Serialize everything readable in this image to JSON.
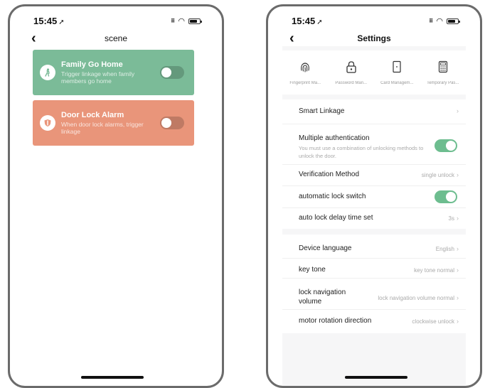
{
  "scene_screen": {
    "status": {
      "time": "15:45"
    },
    "title": "scene",
    "cards": [
      {
        "title": "Family Go Home",
        "description": "Trigger linkage when family members go home",
        "icon": "walking-person-icon",
        "color": "#7bbb98",
        "enabled": false
      },
      {
        "title": "Door Lock Alarm",
        "description": "When door lock alarms, trigger linkage",
        "icon": "shield-icon",
        "color": "#e9957a",
        "enabled": false
      }
    ]
  },
  "settings_screen": {
    "status": {
      "time": "15:45"
    },
    "title": "Settings",
    "unlock_methods": [
      {
        "label": "Fingerprint Ma...",
        "icon": "fingerprint-icon"
      },
      {
        "label": "Password Man...",
        "icon": "padlock-icon"
      },
      {
        "label": "Card Managem...",
        "icon": "card-icon"
      },
      {
        "label": "Temporary Pas...",
        "icon": "keypad-icon"
      }
    ],
    "rows": {
      "smart_linkage": {
        "label": "Smart Linkage"
      },
      "multi_auth": {
        "label": "Multiple authentication",
        "sub": "You must use a combination of unlocking methods to unlock the door.",
        "enabled": true
      },
      "verification": {
        "label": "Verification Method",
        "value": "single unlock"
      },
      "auto_lock": {
        "label": "automatic lock switch",
        "enabled": true
      },
      "auto_lock_delay": {
        "label": "auto lock delay time set",
        "value": "3s"
      },
      "language": {
        "label": "Device language",
        "value": "English"
      },
      "key_tone": {
        "label": "key tone",
        "value": "key tone normal"
      },
      "nav_volume": {
        "label": "lock navigation volume",
        "value": "lock navigation volume normal"
      },
      "motor": {
        "label": "motor rotation direction",
        "value": "clockwise unlock"
      }
    },
    "accent_color": "#6dbd8f"
  }
}
